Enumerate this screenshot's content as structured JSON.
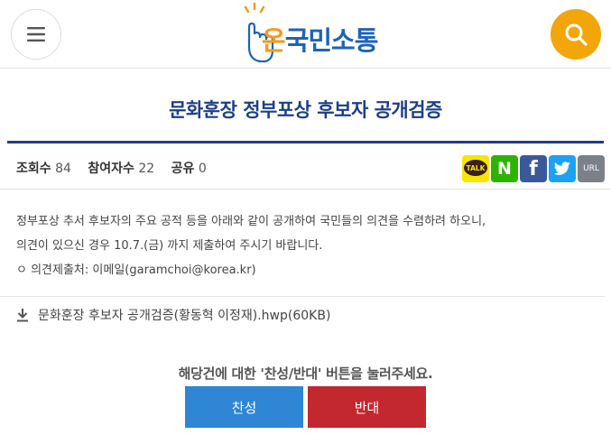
{
  "header": {
    "logo_on": "온",
    "logo_text": "국민소통",
    "menu_icon": "hamburger-icon",
    "search_icon": "search-icon",
    "accent": "#f3a609",
    "brand_blue": "#1f63b4"
  },
  "post": {
    "title": "문화훈장 정부포상 후보자 공개검증",
    "stats": {
      "views_label": "조회수",
      "views": "84",
      "participants_label": "참여자수",
      "participants": "22",
      "shares_label": "공유",
      "shares": "0"
    },
    "share_buttons": {
      "kakao_label": "TALK",
      "naver_label": "N",
      "facebook_label": "f",
      "url_label": "URL"
    },
    "body": {
      "line1": "정부포상 추서 후보자의  주요 공적 등을 아래와 같이 공개하여 국민들의 의견을 수렴하려 하오니,",
      "line2": "의견이 있으신 경우 10.7.(금) 까지 제출하여 주시기 바랍니다.",
      "line3": "ㅇ 의견제출처: 이메일(garamchoi@korea.kr)"
    },
    "attachment": {
      "name": "문화훈장 후보자 공개검증(황동혁 이정재).hwp(60KB)",
      "icon": "download-icon"
    }
  },
  "vote": {
    "prompt": "해당건에 대한 '찬성/반대' 버튼을 눌러주세요.",
    "agree_label": "찬성",
    "disagree_label": "반대",
    "agree_color": "#2e86d4",
    "disagree_color": "#c3282e"
  }
}
